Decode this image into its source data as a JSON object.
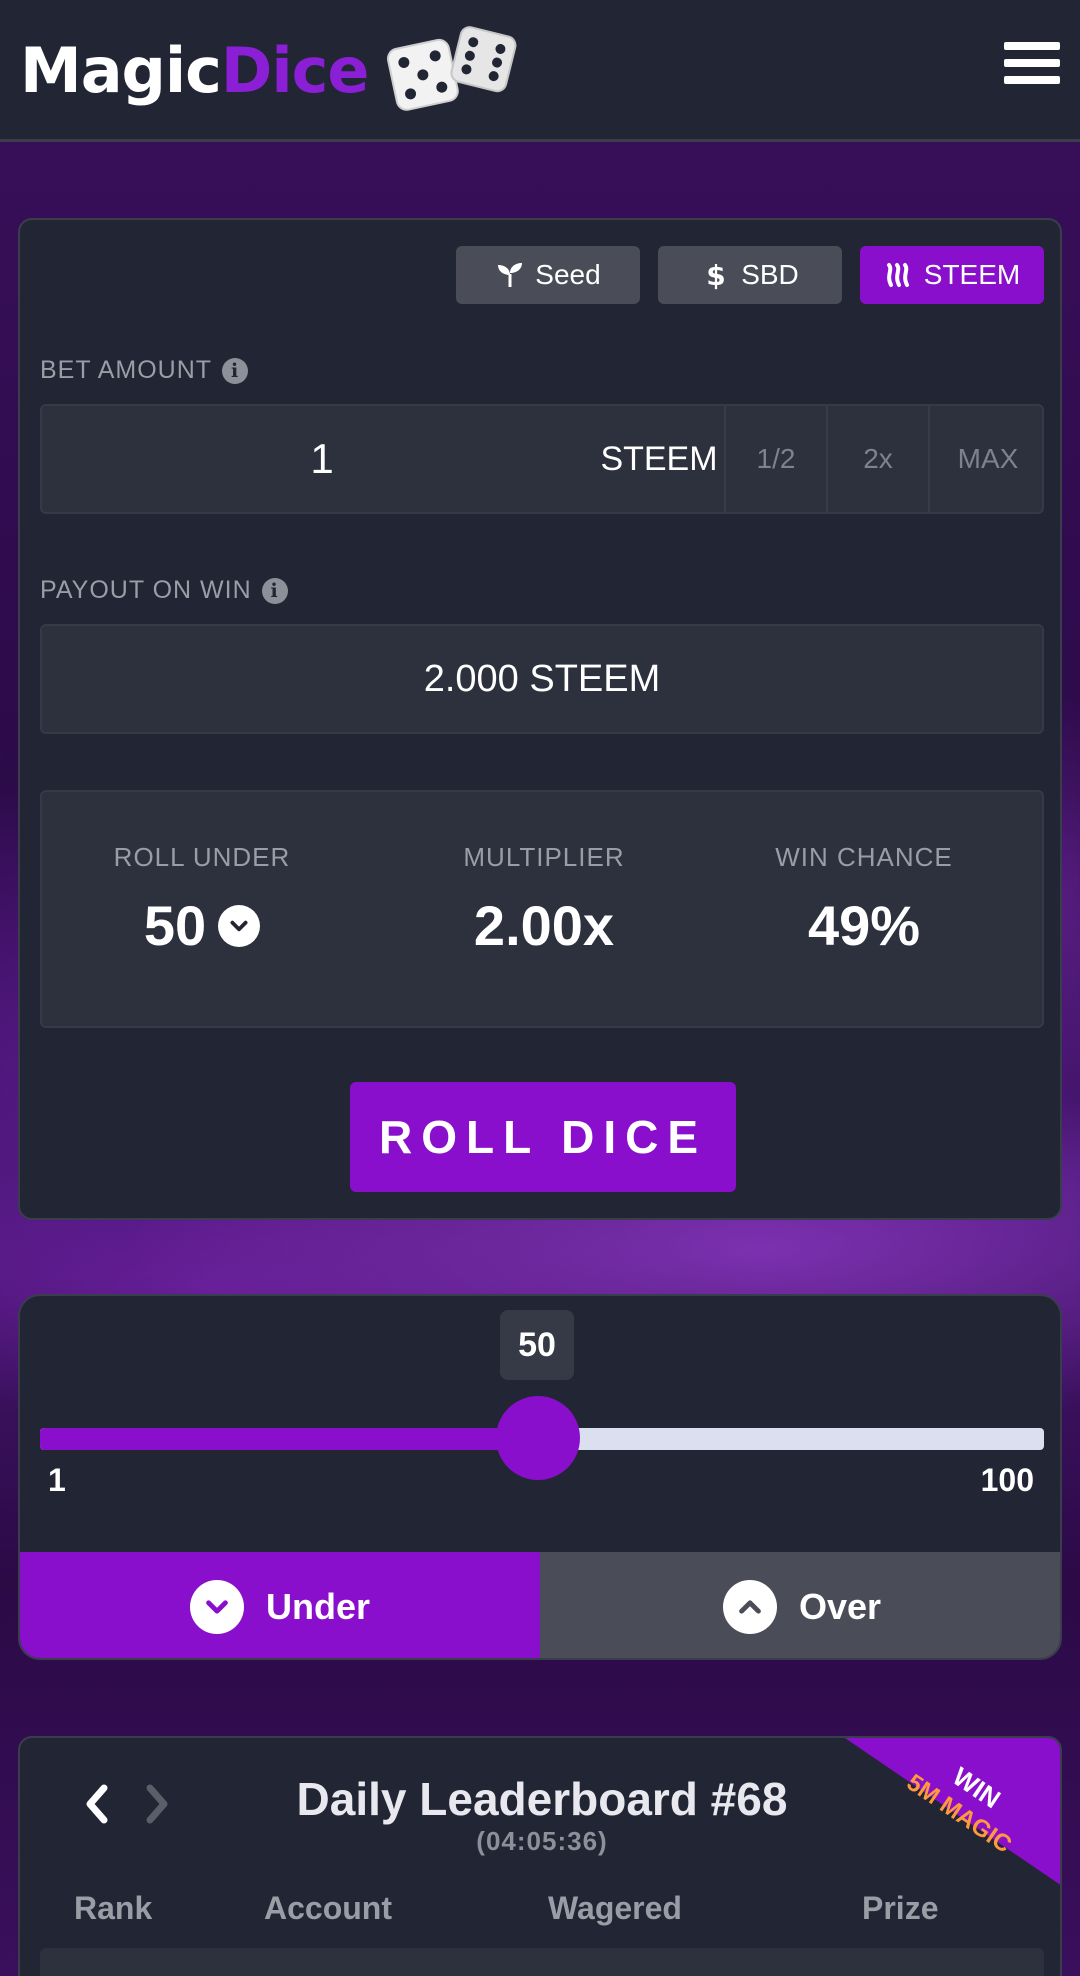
{
  "header": {
    "logo_part1": "Magic",
    "logo_part2": "Dice",
    "logo_icon": "dice-icon",
    "menu_icon": "hamburger-menu-icon"
  },
  "currency_buttons": [
    {
      "label": "Seed",
      "icon": "sprout-icon"
    },
    {
      "label": "SBD",
      "icon": "dollar-icon"
    },
    {
      "label": "STEEM",
      "icon": "steem-icon",
      "selected": true
    }
  ],
  "bet": {
    "label": "BET AMOUNT",
    "value": "1",
    "unit": "STEEM",
    "half_label": "1/2",
    "double_label": "2x",
    "max_label": "MAX"
  },
  "payout": {
    "label": "PAYOUT ON WIN",
    "value": "2.000 STEEM"
  },
  "stats": {
    "roll_under_label": "ROLL UNDER",
    "roll_under_value": "50",
    "multiplier_label": "MULTIPLIER",
    "multiplier_value": "2.00x",
    "win_chance_label": "WIN CHANCE",
    "win_chance_value": "49%"
  },
  "roll_button": "ROLL DICE",
  "slider": {
    "value": "50",
    "min": "1",
    "max": "100",
    "under_label": "Under",
    "over_label": "Over",
    "selected_direction": "Under"
  },
  "leaderboard": {
    "title": "Daily Leaderboard #68",
    "timer": "(04:05:36)",
    "ribbon_line1": "WIN",
    "ribbon_line2": "5M MAGIC",
    "columns": [
      "Rank",
      "Account",
      "Wagered",
      "Prize"
    ]
  },
  "colors": {
    "accent": "#8a0fcc",
    "panel": "#222533",
    "field": "#2d313e",
    "ribbon_prize": "#ff9a3c"
  }
}
